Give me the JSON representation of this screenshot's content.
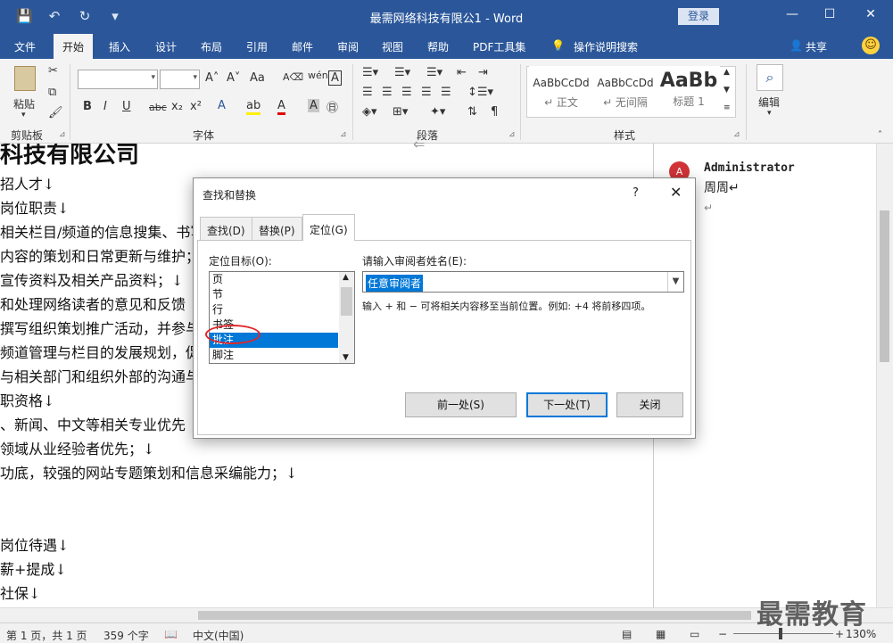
{
  "window": {
    "title": "最需网络科技有限公1 - Word",
    "login": "登录",
    "minimize": "—",
    "restore": "☐",
    "close": "✕",
    "quick_access": [
      "💾",
      "↶",
      "↻",
      "▾"
    ]
  },
  "menu": {
    "items": [
      "文件",
      "开始",
      "插入",
      "设计",
      "布局",
      "引用",
      "邮件",
      "审阅",
      "视图",
      "帮助",
      "PDF工具集",
      "操作说明搜索"
    ],
    "active": "开始",
    "share": "共享",
    "tellme_icon": "lightbulb-icon",
    "share_icon": "person-icon"
  },
  "ribbon": {
    "groups": [
      "剪贴板",
      "字体",
      "段落",
      "样式",
      "编辑"
    ],
    "paste_label": "粘贴",
    "font_name": "",
    "font_size": "",
    "font_buttons": [
      "B",
      "I",
      "U",
      "abc",
      "x₂",
      "x²"
    ],
    "styles": [
      {
        "sample": "AaBbCcDd",
        "name": "↵ 正文"
      },
      {
        "sample": "AaBbCcDd",
        "name": "↵ 无间隔"
      },
      {
        "sample": "AaBb",
        "name": "标题 1"
      }
    ],
    "edit_label": "编辑"
  },
  "document": {
    "heading": "科技有限公司",
    "lines": [
      "招人才↓",
      "岗位职责↓",
      "相关栏目/频道的信息搜集、书写",
      "内容的策划和日常更新与维护；",
      "宣传资料及相关产品资料；↓",
      "和处理网络读者的意见和反馈",
      "撰写组织策划推广活动，并参与",
      "频道管理与栏目的发展规划，促",
      "与相关部门和组织外部的沟通与",
      "职资格↓",
      "、新闻、中文等相关专业优先",
      "领域从业经验者优先；↓",
      "功底，较强的网站专题策划和信息采编能力；↓",
      "",
      "",
      "岗位待遇↓",
      "薪+提成↓",
      "社保↓"
    ]
  },
  "comment": {
    "avatar_letter": "A",
    "author": "Administrator",
    "text": "周周↵",
    "mark": "↵"
  },
  "status": {
    "page": "第 1 页，共 1 页",
    "words": "359 个字",
    "lang": "中文(中国)",
    "zoom": "130%",
    "zoom_level": 0.47
  },
  "watermark": "最需教育",
  "dialog": {
    "title": "查找和替换",
    "help": "?",
    "close": "✕",
    "tabs": [
      "查找(D)",
      "替换(P)",
      "定位(G)"
    ],
    "active_tab": 2,
    "goto_label": "定位目标(O):",
    "goto_items": [
      "页",
      "节",
      "行",
      "书签",
      "批注",
      "脚注"
    ],
    "selected_index": 4,
    "reviewer_label": "请输入审阅者姓名(E):",
    "reviewer_value": "任意审阅者",
    "hint": "输入 + 和 − 可将相关内容移至当前位置。例如: +4 将前移四项。",
    "buttons": [
      "前一处(S)",
      "下一处(T)",
      "关闭"
    ]
  }
}
